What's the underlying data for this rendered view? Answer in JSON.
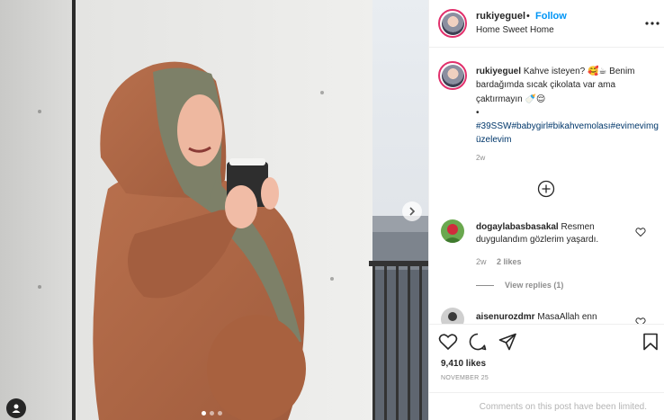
{
  "colors": {
    "accent": "#0095f6",
    "hashtag": "#00376b",
    "muted": "#8e8e8e",
    "text": "#262626"
  },
  "post": {
    "username": "rukiyeguel",
    "separator": "•",
    "follow_label": "Follow",
    "location": "Home Sweet Home",
    "more_icon": "more-horizontal-icon"
  },
  "caption": {
    "username": "rukiyeguel",
    "text": "Kahve isteyen? 🥰☕ Benim bardağımda sıcak çikolata var ama çaktırmayın 🍼😌",
    "bullet": "•",
    "hashtags": "#39SSW#babygirl#bikahvemolası#evimevimgüzelevim",
    "time": "2w"
  },
  "load_more_icon": "plus-circle-icon",
  "comments": [
    {
      "username": "dogaylabasbasakal",
      "text": "Resmen duygulandım gözlerim yaşardı.",
      "time": "2w",
      "likes": "2 likes",
      "view_replies": "View replies (1)"
    },
    {
      "username": "aisenurozdmr",
      "text": "MasaAllah enn"
    }
  ],
  "actions": {
    "likes": "9,410 likes",
    "date": "NOVEMBER 25",
    "comments_limited": "Comments on this post have been limited."
  },
  "carousel": {
    "slides": 3,
    "active": 1
  }
}
